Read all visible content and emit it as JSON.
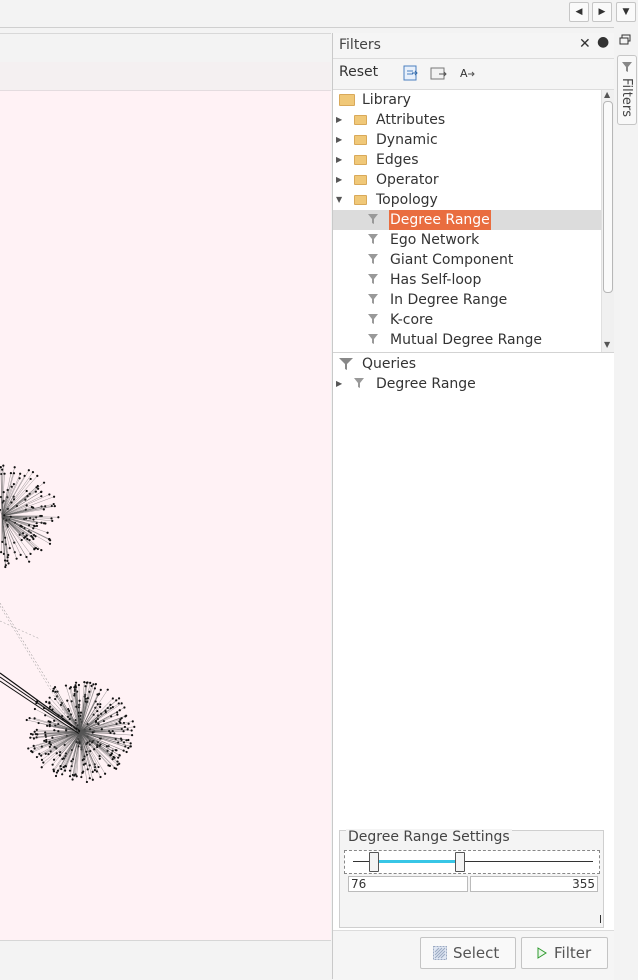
{
  "window": {
    "nav": {
      "left": "◀",
      "right": "▶",
      "down": "▼"
    }
  },
  "filters_panel": {
    "title": "Filters",
    "close": "✕",
    "minimize": "●",
    "toolbar": {
      "reset_label": "Reset"
    },
    "library": {
      "root_label": "Library",
      "folders": [
        {
          "label": "Attributes",
          "expanded": false
        },
        {
          "label": "Dynamic",
          "expanded": false
        },
        {
          "label": "Edges",
          "expanded": false
        },
        {
          "label": "Operator",
          "expanded": false
        },
        {
          "label": "Topology",
          "expanded": true
        }
      ],
      "topology_items": [
        "Degree Range",
        "Ego Network",
        "Giant Component",
        "Has Self-loop",
        "In Degree Range",
        "K-core",
        "Mutual Degree Range"
      ],
      "selected_item": "Degree Range"
    },
    "queries": {
      "root_label": "Queries",
      "items": [
        "Degree Range"
      ]
    },
    "settings": {
      "title": "Degree Range Settings",
      "min_value": "76",
      "max_value": "355"
    },
    "buttons": {
      "select_label": "Select",
      "filter_label": "Filter"
    }
  },
  "side_tab": {
    "label": "Filters"
  },
  "colors": {
    "canvas_bg": "#fff2f5",
    "selection": "#e96d3f",
    "slider_range": "#38c6e6"
  }
}
